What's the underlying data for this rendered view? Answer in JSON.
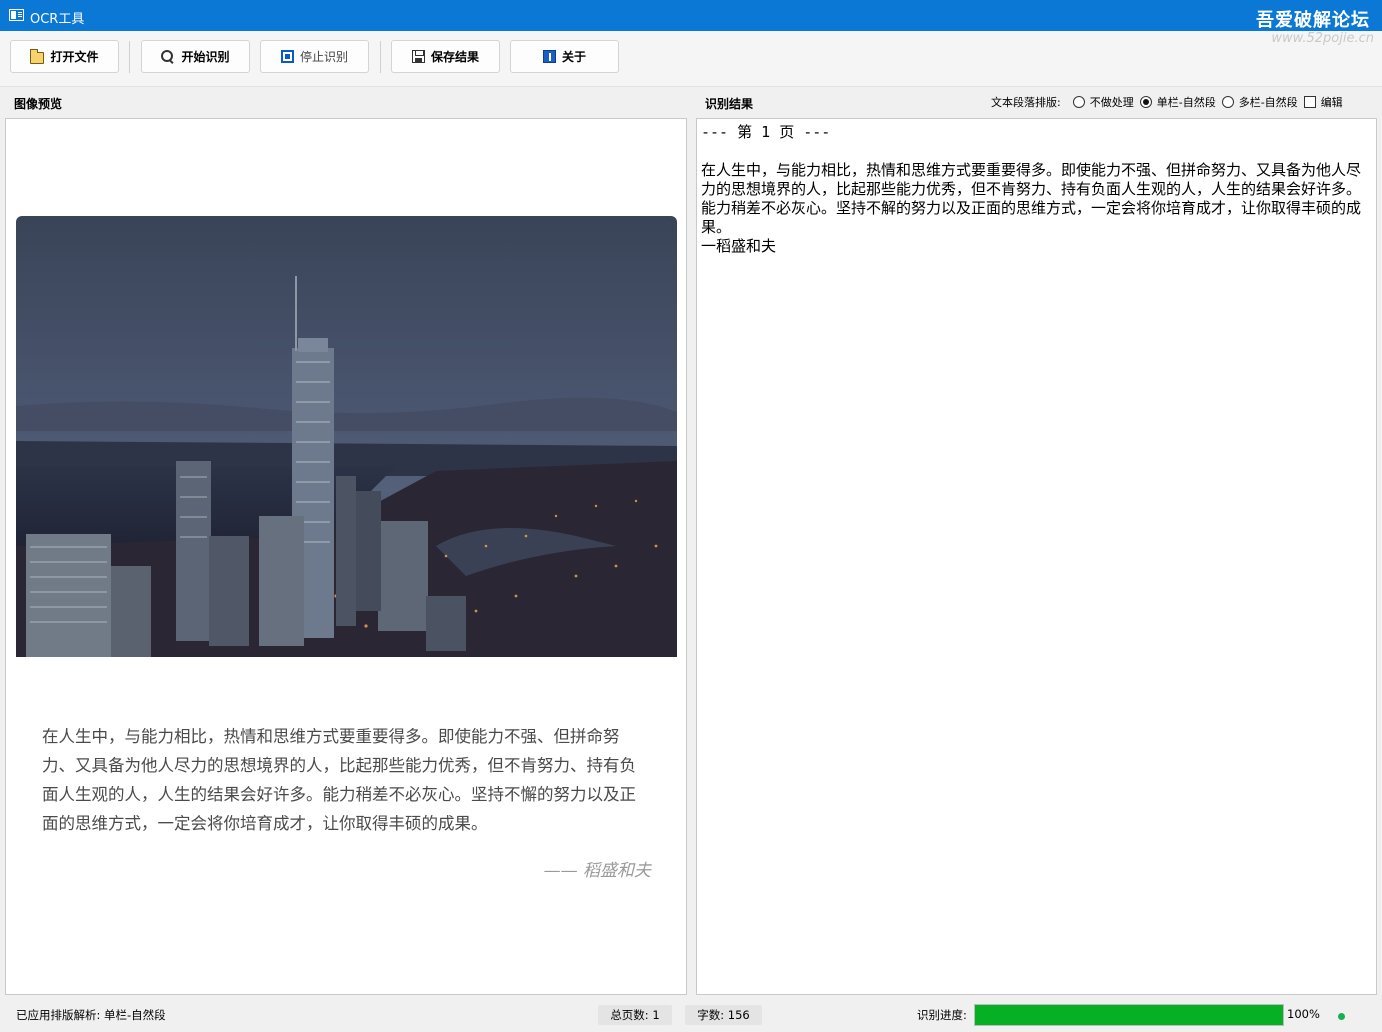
{
  "window": {
    "title": "OCR工具",
    "watermark": "吾爱破解论坛",
    "watermark_url": "www.52pojie.cn"
  },
  "toolbar": {
    "open_file": "打开文件",
    "start_ocr": "开始识别",
    "stop_ocr": "停止识别",
    "save_result": "保存结果",
    "about": "关于"
  },
  "preview": {
    "label": "图像预览",
    "quote_text": "在人生中，与能力相比，热情和思维方式要重要得多。即使能力不强、但拼命努力、又具备为他人尽力的思想境界的人，比起那些能力优秀，但不肯努力、持有负面人生观的人，人生的结果会好许多。能力稍差不必灰心。坚持不懈的努力以及正面的思维方式，一定会将你培育成才，让你取得丰硕的成果。",
    "quote_author": "—— 稻盛和夫"
  },
  "result": {
    "label": "识别结果",
    "layout_label": "文本段落排版:",
    "options": [
      "不做处理",
      "单栏-自然段",
      "多栏-自然段"
    ],
    "selected_option": "单栏-自然段",
    "edit_label": "编辑",
    "edit_checked": false,
    "text": "--- 第 1 页 ---\n\n在人生中，与能力相比，热情和思维方式要重要得多。即使能力不强、但拼命努力、又具备为他人尽力的思想境界的人，比起那些能力优秀，但不肯努力、持有负面人生观的人，人生的结果会好许多。能力稍差不必灰心。坚持不解的努力以及正面的思维方式，一定会将你培育成才，让你取得丰硕的成果。\n一稻盛和夫"
  },
  "status": {
    "layout_applied": "已应用排版解析: 单栏-自然段",
    "total_pages": "总页数: 1",
    "char_count": "字数: 156",
    "progress_label": "识别进度:",
    "progress_value": 100,
    "progress_text": "100%"
  },
  "colors": {
    "titlebar": "#0a78d4",
    "progress": "#06b025",
    "status_dot": "#17b04a"
  }
}
